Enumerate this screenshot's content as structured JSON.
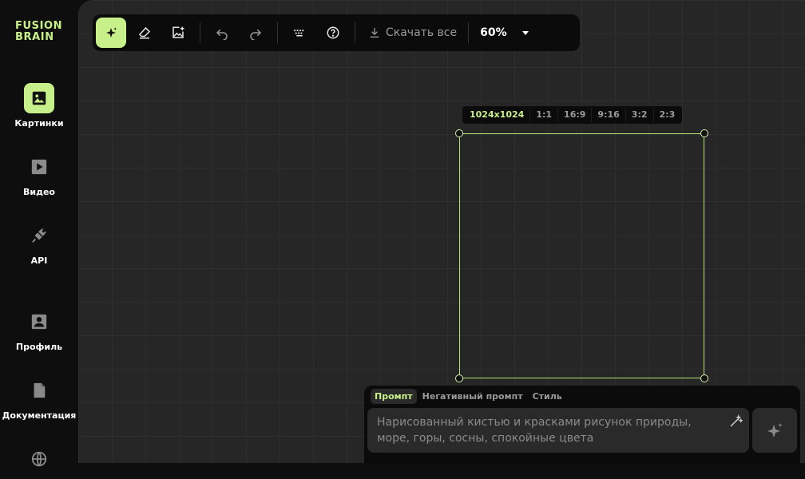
{
  "brand": {
    "line1": "FUSION",
    "line2": "BRAIN",
    "color": "#c8f08a"
  },
  "sidebar": {
    "items": [
      {
        "label": "Картинки",
        "icon": "image-icon",
        "active": true
      },
      {
        "label": "Видео",
        "icon": "video-icon",
        "active": false
      },
      {
        "label": "API",
        "icon": "plug-icon",
        "active": false
      },
      {
        "label": "Профиль",
        "icon": "profile-icon",
        "active": false
      },
      {
        "label": "Документация",
        "icon": "document-icon",
        "active": false
      },
      {
        "label": "",
        "icon": "globe-icon",
        "active": false
      }
    ]
  },
  "toolbar": {
    "tools": [
      {
        "icon": "sparkle-icon",
        "active": true
      },
      {
        "icon": "eraser-icon",
        "active": false
      },
      {
        "icon": "add-image-icon",
        "active": false
      },
      {
        "icon": "undo-icon",
        "active": false
      },
      {
        "icon": "redo-icon",
        "active": false
      },
      {
        "icon": "keyboard-icon",
        "active": false
      },
      {
        "icon": "help-icon",
        "active": false
      }
    ],
    "download_label": "Скачать все",
    "zoom": "60%"
  },
  "sizes": {
    "options": [
      "1024x1024",
      "1:1",
      "16:9",
      "9:16",
      "3:2",
      "2:3"
    ],
    "selected": "1024x1024"
  },
  "prompt": {
    "tabs": [
      "Промпт",
      "Негативный промпт",
      "Стиль"
    ],
    "active_tab": "Промпт",
    "placeholder": "Нарисованный кистью и красками рисунок природы, море, горы, сосны, спокойные цвета"
  },
  "colors": {
    "accent": "#c8f08a",
    "canvas_bg": "#262626",
    "panel_bg": "#0b0b0b"
  }
}
